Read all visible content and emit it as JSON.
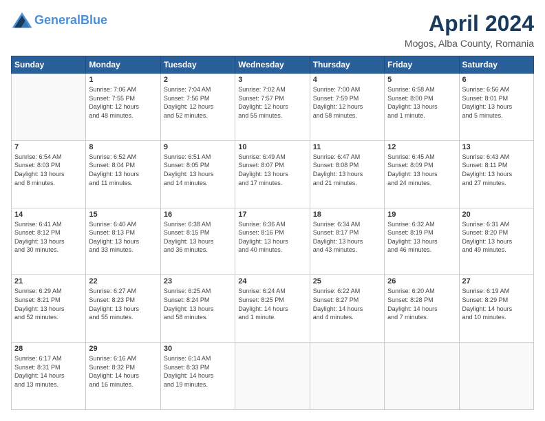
{
  "header": {
    "logo_line1": "General",
    "logo_line2": "Blue",
    "month_title": "April 2024",
    "location": "Mogos, Alba County, Romania"
  },
  "weekdays": [
    "Sunday",
    "Monday",
    "Tuesday",
    "Wednesday",
    "Thursday",
    "Friday",
    "Saturday"
  ],
  "weeks": [
    [
      {
        "day": "",
        "info": ""
      },
      {
        "day": "1",
        "info": "Sunrise: 7:06 AM\nSunset: 7:55 PM\nDaylight: 12 hours\nand 48 minutes."
      },
      {
        "day": "2",
        "info": "Sunrise: 7:04 AM\nSunset: 7:56 PM\nDaylight: 12 hours\nand 52 minutes."
      },
      {
        "day": "3",
        "info": "Sunrise: 7:02 AM\nSunset: 7:57 PM\nDaylight: 12 hours\nand 55 minutes."
      },
      {
        "day": "4",
        "info": "Sunrise: 7:00 AM\nSunset: 7:59 PM\nDaylight: 12 hours\nand 58 minutes."
      },
      {
        "day": "5",
        "info": "Sunrise: 6:58 AM\nSunset: 8:00 PM\nDaylight: 13 hours\nand 1 minute."
      },
      {
        "day": "6",
        "info": "Sunrise: 6:56 AM\nSunset: 8:01 PM\nDaylight: 13 hours\nand 5 minutes."
      }
    ],
    [
      {
        "day": "7",
        "info": "Sunrise: 6:54 AM\nSunset: 8:03 PM\nDaylight: 13 hours\nand 8 minutes."
      },
      {
        "day": "8",
        "info": "Sunrise: 6:52 AM\nSunset: 8:04 PM\nDaylight: 13 hours\nand 11 minutes."
      },
      {
        "day": "9",
        "info": "Sunrise: 6:51 AM\nSunset: 8:05 PM\nDaylight: 13 hours\nand 14 minutes."
      },
      {
        "day": "10",
        "info": "Sunrise: 6:49 AM\nSunset: 8:07 PM\nDaylight: 13 hours\nand 17 minutes."
      },
      {
        "day": "11",
        "info": "Sunrise: 6:47 AM\nSunset: 8:08 PM\nDaylight: 13 hours\nand 21 minutes."
      },
      {
        "day": "12",
        "info": "Sunrise: 6:45 AM\nSunset: 8:09 PM\nDaylight: 13 hours\nand 24 minutes."
      },
      {
        "day": "13",
        "info": "Sunrise: 6:43 AM\nSunset: 8:11 PM\nDaylight: 13 hours\nand 27 minutes."
      }
    ],
    [
      {
        "day": "14",
        "info": "Sunrise: 6:41 AM\nSunset: 8:12 PM\nDaylight: 13 hours\nand 30 minutes."
      },
      {
        "day": "15",
        "info": "Sunrise: 6:40 AM\nSunset: 8:13 PM\nDaylight: 13 hours\nand 33 minutes."
      },
      {
        "day": "16",
        "info": "Sunrise: 6:38 AM\nSunset: 8:15 PM\nDaylight: 13 hours\nand 36 minutes."
      },
      {
        "day": "17",
        "info": "Sunrise: 6:36 AM\nSunset: 8:16 PM\nDaylight: 13 hours\nand 40 minutes."
      },
      {
        "day": "18",
        "info": "Sunrise: 6:34 AM\nSunset: 8:17 PM\nDaylight: 13 hours\nand 43 minutes."
      },
      {
        "day": "19",
        "info": "Sunrise: 6:32 AM\nSunset: 8:19 PM\nDaylight: 13 hours\nand 46 minutes."
      },
      {
        "day": "20",
        "info": "Sunrise: 6:31 AM\nSunset: 8:20 PM\nDaylight: 13 hours\nand 49 minutes."
      }
    ],
    [
      {
        "day": "21",
        "info": "Sunrise: 6:29 AM\nSunset: 8:21 PM\nDaylight: 13 hours\nand 52 minutes."
      },
      {
        "day": "22",
        "info": "Sunrise: 6:27 AM\nSunset: 8:23 PM\nDaylight: 13 hours\nand 55 minutes."
      },
      {
        "day": "23",
        "info": "Sunrise: 6:25 AM\nSunset: 8:24 PM\nDaylight: 13 hours\nand 58 minutes."
      },
      {
        "day": "24",
        "info": "Sunrise: 6:24 AM\nSunset: 8:25 PM\nDaylight: 14 hours\nand 1 minute."
      },
      {
        "day": "25",
        "info": "Sunrise: 6:22 AM\nSunset: 8:27 PM\nDaylight: 14 hours\nand 4 minutes."
      },
      {
        "day": "26",
        "info": "Sunrise: 6:20 AM\nSunset: 8:28 PM\nDaylight: 14 hours\nand 7 minutes."
      },
      {
        "day": "27",
        "info": "Sunrise: 6:19 AM\nSunset: 8:29 PM\nDaylight: 14 hours\nand 10 minutes."
      }
    ],
    [
      {
        "day": "28",
        "info": "Sunrise: 6:17 AM\nSunset: 8:31 PM\nDaylight: 14 hours\nand 13 minutes."
      },
      {
        "day": "29",
        "info": "Sunrise: 6:16 AM\nSunset: 8:32 PM\nDaylight: 14 hours\nand 16 minutes."
      },
      {
        "day": "30",
        "info": "Sunrise: 6:14 AM\nSunset: 8:33 PM\nDaylight: 14 hours\nand 19 minutes."
      },
      {
        "day": "",
        "info": ""
      },
      {
        "day": "",
        "info": ""
      },
      {
        "day": "",
        "info": ""
      },
      {
        "day": "",
        "info": ""
      }
    ]
  ]
}
